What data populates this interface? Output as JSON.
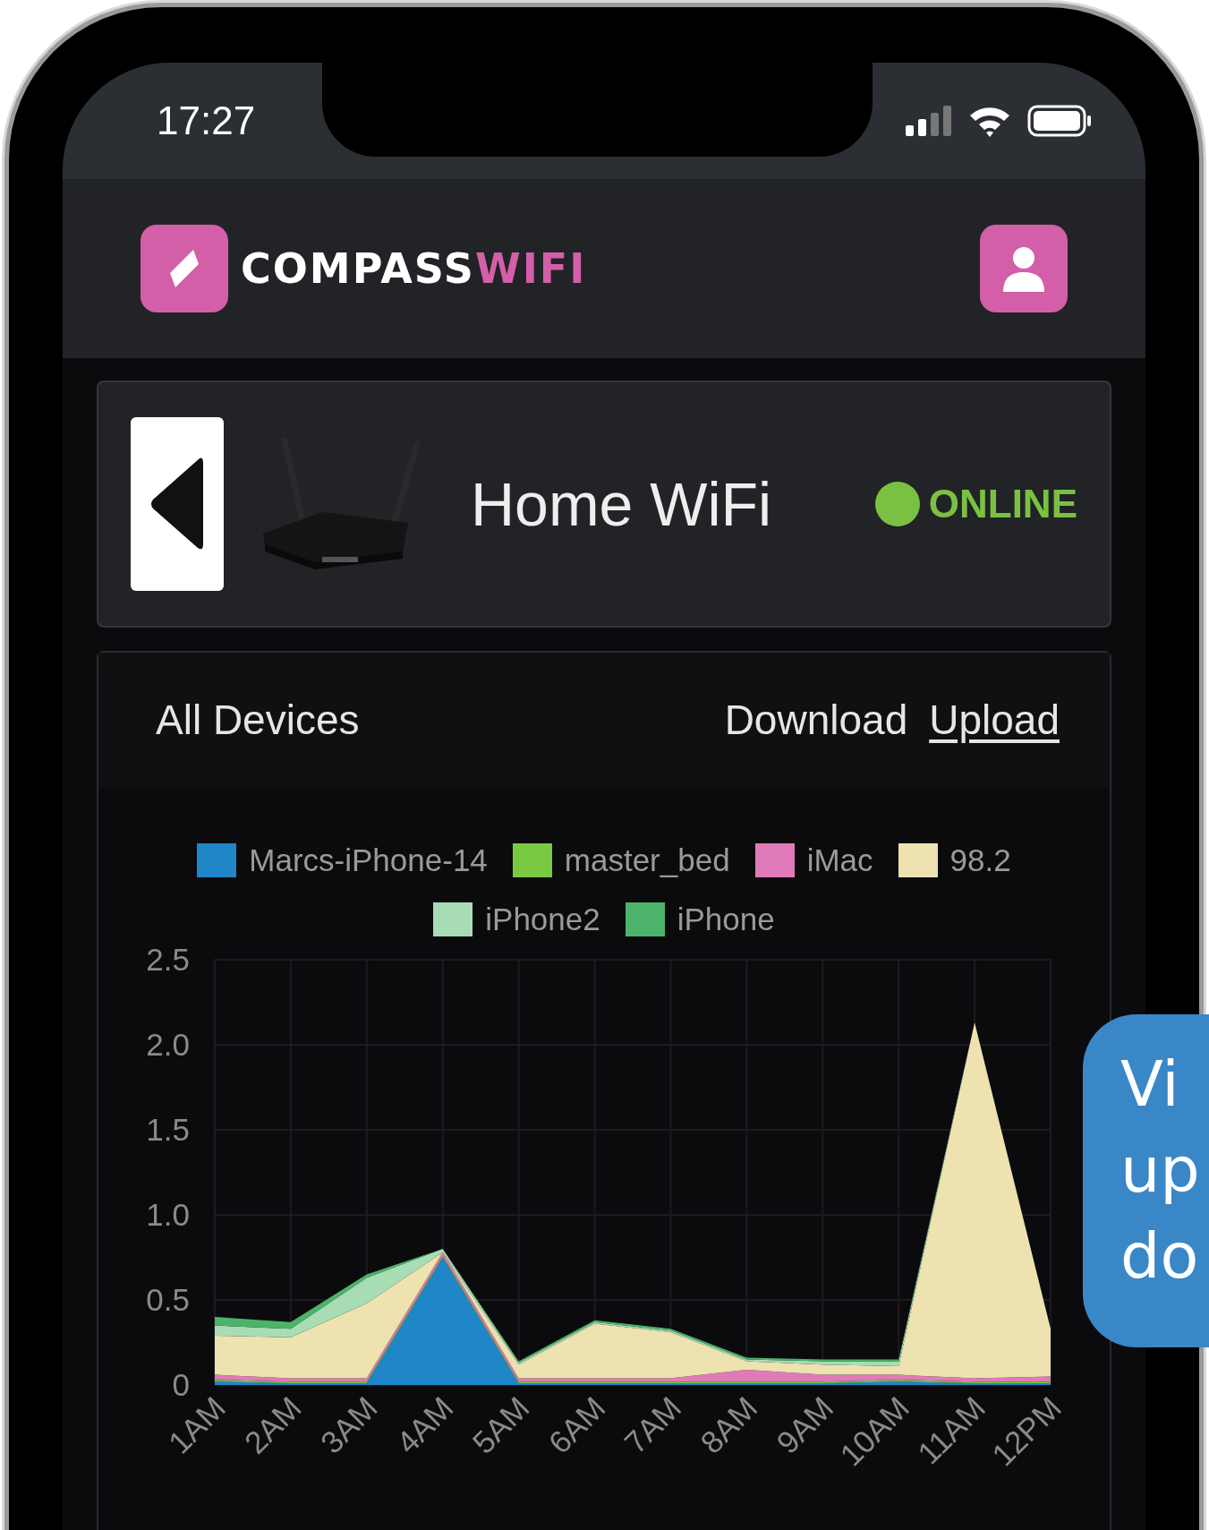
{
  "status_bar": {
    "time": "17:27"
  },
  "header": {
    "logo": {
      "word_1": "COMPASS",
      "word_2": "WIFI"
    }
  },
  "network": {
    "name": "Home WiFi",
    "status": "ONLINE",
    "online": true
  },
  "usage": {
    "scope": "All Devices",
    "tabs": [
      {
        "label": "Download",
        "selected": false
      },
      {
        "label": "Upload",
        "selected": true
      }
    ],
    "chart_data": {
      "type": "area",
      "stacked": true,
      "grid": true,
      "categories": [
        "1AM",
        "2AM",
        "3AM",
        "4AM",
        "5AM",
        "6AM",
        "7AM",
        "8AM",
        "9AM",
        "10AM",
        "11AM",
        "12PM"
      ],
      "ylim": [
        0,
        2.5
      ],
      "yticks": [
        0,
        0.5,
        {
          "value": 1,
          "label": "1.0"
        },
        1.5,
        {
          "value": 2,
          "label": "2.0"
        },
        2.5
      ],
      "series": [
        {
          "name": "Marcs-iPhone-14",
          "color": "#1f86c8",
          "values": [
            0.02,
            0.01,
            0.01,
            0.75,
            0.01,
            0.01,
            0.01,
            0.01,
            0.01,
            0.02,
            0.01,
            0.01
          ]
        },
        {
          "name": "master_bed",
          "color": "#7ac943",
          "values": [
            0.01,
            0.01,
            0.01,
            0.01,
            0.01,
            0.01,
            0.01,
            0.01,
            0.01,
            0.01,
            0.01,
            0.01
          ]
        },
        {
          "name": "iMac",
          "color": "#e07ab8",
          "values": [
            0.03,
            0.02,
            0.02,
            0.02,
            0.02,
            0.02,
            0.02,
            0.07,
            0.04,
            0.03,
            0.02,
            0.03
          ]
        },
        {
          "name": "98.2",
          "color": "#ede2b0",
          "values": [
            0.23,
            0.24,
            0.44,
            0.0,
            0.08,
            0.32,
            0.27,
            0.05,
            0.06,
            0.05,
            2.09,
            0.28
          ]
        },
        {
          "name": "iPhone2",
          "color": "#a8dcb5",
          "values": [
            0.06,
            0.05,
            0.15,
            0.02,
            0.01,
            0.01,
            0.01,
            0.01,
            0.02,
            0.03,
            0,
            0
          ]
        },
        {
          "name": "iPhone",
          "color": "#4cb46a",
          "values": [
            0.05,
            0.04,
            0.02,
            0,
            0.01,
            0.01,
            0.01,
            0.01,
            0.01,
            0.01,
            0,
            0
          ]
        }
      ]
    }
  },
  "callout": {
    "lines": [
      "Vi",
      "up",
      "do"
    ]
  }
}
